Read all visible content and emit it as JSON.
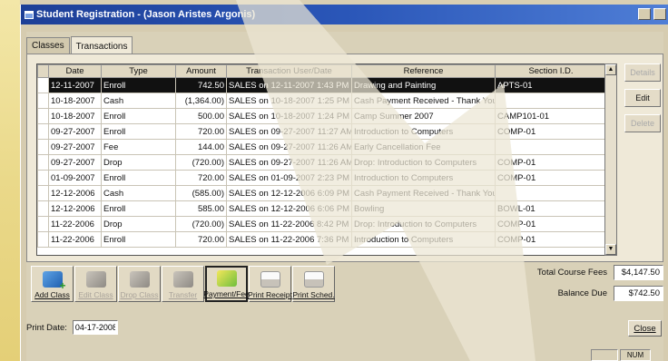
{
  "window": {
    "title": "Student Registration - (Jason Aristes Argonis)"
  },
  "tabs": [
    {
      "label": "Classes"
    },
    {
      "label": "Transactions"
    }
  ],
  "table": {
    "columns": [
      "Date",
      "Type",
      "Amount",
      "Transaction User/Date",
      "Reference",
      "Section I.D."
    ],
    "rows": [
      [
        "12-11-2007",
        "Enroll",
        "742.50",
        "SALES on 12-11-2007 1:43 PM",
        "Drawing and Painting",
        "APTS-01"
      ],
      [
        "10-18-2007",
        "Cash",
        "(1,364.00)",
        "SALES on 10-18-2007 1:25 PM",
        "Cash Payment Received - Thank You",
        ""
      ],
      [
        "10-18-2007",
        "Enroll",
        "500.00",
        "SALES on 10-18-2007 1:24 PM",
        "Camp Summer 2007",
        "CAMP101-01"
      ],
      [
        "09-27-2007",
        "Enroll",
        "720.00",
        "SALES on 09-27-2007 11:27 AM",
        "Introduction to Computers",
        "COMP-01"
      ],
      [
        "09-27-2007",
        "Fee",
        "144.00",
        "SALES on 09-27-2007 11:26 AM",
        "Early Cancellation Fee",
        ""
      ],
      [
        "09-27-2007",
        "Drop",
        "(720.00)",
        "SALES on 09-27-2007 11:26 AM",
        "Drop: Introduction to Computers",
        "COMP-01"
      ],
      [
        "01-09-2007",
        "Enroll",
        "720.00",
        "SALES on 01-09-2007 2:23 PM",
        "Introduction to Computers",
        "COMP-01"
      ],
      [
        "12-12-2006",
        "Cash",
        "(585.00)",
        "SALES on 12-12-2006 6:09 PM",
        "Cash Payment Received - Thank You",
        ""
      ],
      [
        "12-12-2006",
        "Enroll",
        "585.00",
        "SALES on 12-12-2006 6:06 PM",
        "Bowling",
        "BOWL-01"
      ],
      [
        "11-22-2006",
        "Drop",
        "(720.00)",
        "SALES on 11-22-2006 8:42 PM",
        "Drop: Introduction to Computers",
        "COMP-01"
      ],
      [
        "11-22-2006",
        "Enroll",
        "720.00",
        "SALES on 11-22-2006 7:36 PM",
        "Introduction to Computers",
        "COMP-01"
      ]
    ]
  },
  "side_buttons": {
    "details": "Details",
    "edit": "Edit",
    "delete": "Delete"
  },
  "toolbar": {
    "add_class": "Add Class",
    "edit_class": "Edit Class",
    "drop_class": "Drop Class",
    "transfer": "Transfer",
    "payment_fee": "Payment/Fee",
    "print_receipt": "Print Receipt",
    "print_sched": "Print Sched."
  },
  "totals": {
    "total_course_fees_label": "Total Course Fees",
    "total_course_fees": "$4,147.50",
    "balance_due_label": "Balance Due",
    "balance_due": "$742.50"
  },
  "footer": {
    "print_date_label": "Print Date:",
    "print_date": "04-17-2008",
    "close": "Close"
  },
  "status": {
    "num": "NUM"
  },
  "colors": {
    "titlebar": "#2a56b8",
    "selected_row": "#111111",
    "overlay_arrow": "#e8e1cc"
  }
}
